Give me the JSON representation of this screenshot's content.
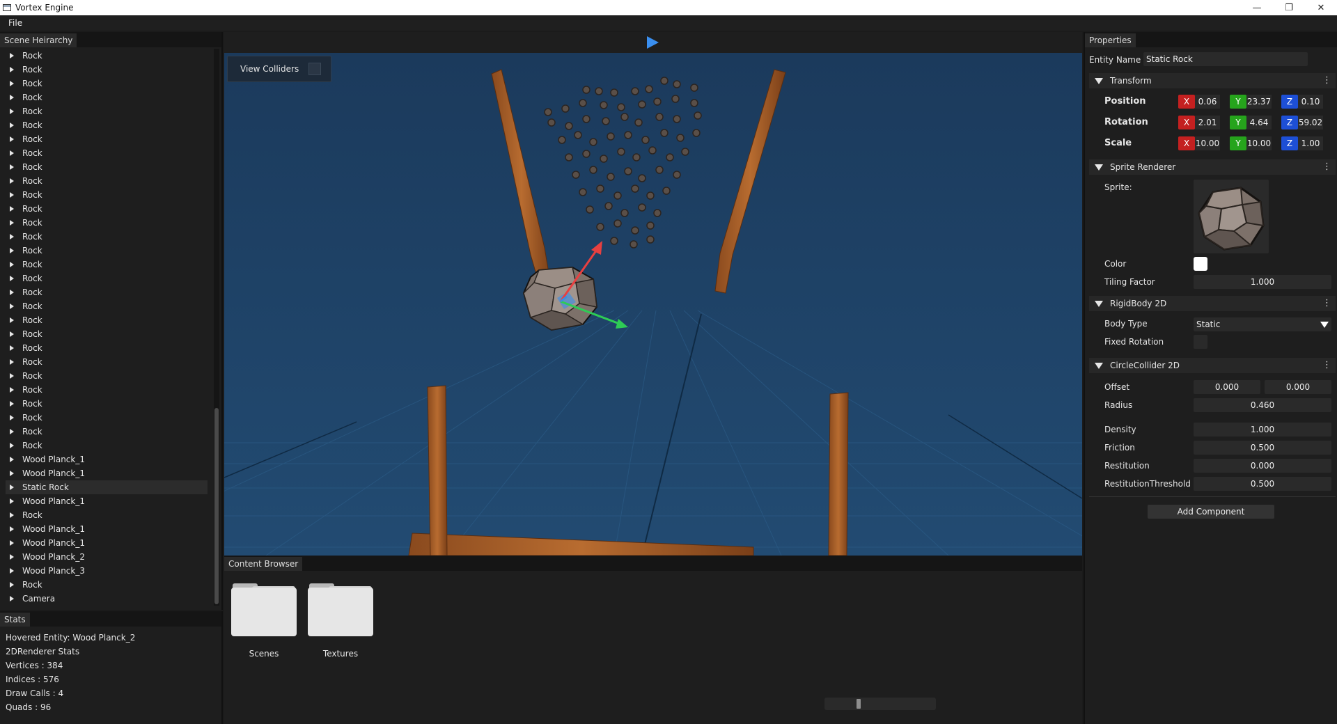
{
  "window": {
    "title": "Vortex Engine",
    "controls": {
      "minimize": "—",
      "restore": "❐",
      "close": "✕"
    }
  },
  "menu": {
    "file_label": "File"
  },
  "hierarchy": {
    "tab_label": "Scene Heirarchy",
    "items": [
      {
        "label": "Rock"
      },
      {
        "label": "Rock"
      },
      {
        "label": "Rock"
      },
      {
        "label": "Rock"
      },
      {
        "label": "Rock"
      },
      {
        "label": "Rock"
      },
      {
        "label": "Rock"
      },
      {
        "label": "Rock"
      },
      {
        "label": "Rock"
      },
      {
        "label": "Rock"
      },
      {
        "label": "Rock"
      },
      {
        "label": "Rock"
      },
      {
        "label": "Rock"
      },
      {
        "label": "Rock"
      },
      {
        "label": "Rock"
      },
      {
        "label": "Rock"
      },
      {
        "label": "Rock"
      },
      {
        "label": "Rock"
      },
      {
        "label": "Rock"
      },
      {
        "label": "Rock"
      },
      {
        "label": "Rock"
      },
      {
        "label": "Rock"
      },
      {
        "label": "Rock"
      },
      {
        "label": "Rock"
      },
      {
        "label": "Rock"
      },
      {
        "label": "Rock"
      },
      {
        "label": "Rock"
      },
      {
        "label": "Rock"
      },
      {
        "label": "Rock"
      },
      {
        "label": "Wood Planck_1"
      },
      {
        "label": "Wood Planck_1"
      },
      {
        "label": "Static Rock",
        "selected": true
      },
      {
        "label": "Wood Planck_1"
      },
      {
        "label": "Rock"
      },
      {
        "label": "Wood Planck_1"
      },
      {
        "label": "Wood Planck_1"
      },
      {
        "label": "Wood Planck_2"
      },
      {
        "label": "Wood Planck_3"
      },
      {
        "label": "Rock"
      },
      {
        "label": "Camera"
      }
    ]
  },
  "stats": {
    "tab_label": "Stats",
    "hovered": "Hovered Entity: Wood Planck_2",
    "renderer": "2DRenderer Stats",
    "vertices": "Vertices : 384",
    "indices": "Indices : 576",
    "draw_calls": "Draw Calls : 4",
    "quads": "Quads : 96"
  },
  "viewport": {
    "view_colliders_label": "View Colliders",
    "view_colliders_checked": false,
    "background_color": "#1e4063",
    "gizmo_colors": {
      "x": "#e84040",
      "y": "#2ecc55",
      "z": "#3b8fe0"
    }
  },
  "content_browser": {
    "tab_label": "Content Browser",
    "folders": [
      {
        "label": "Scenes"
      },
      {
        "label": "Textures"
      }
    ],
    "thumbnail_size_fraction": 0.3
  },
  "properties": {
    "tab_label": "Properties",
    "entity_name_label": "Entity Name",
    "entity_name": "Static Rock",
    "transform": {
      "header": "Transform",
      "position_label": "Position",
      "rotation_label": "Rotation",
      "scale_label": "Scale",
      "axis_x": "X",
      "axis_y": "Y",
      "axis_z": "Z",
      "position": {
        "x": "0.06",
        "y": "23.37",
        "z": "0.10"
      },
      "rotation": {
        "x": "2.01",
        "y": "4.64",
        "z": "59.02"
      },
      "scale": {
        "x": "10.00",
        "y": "10.00",
        "z": "1.00"
      }
    },
    "sprite_renderer": {
      "header": "Sprite Renderer",
      "sprite_label": "Sprite:",
      "color_label": "Color",
      "color_value": "#ffffff",
      "tiling_label": "Tiling Factor",
      "tiling_value": "1.000"
    },
    "rigidbody": {
      "header": "RigidBody 2D",
      "body_type_label": "Body Type",
      "body_type_value": "Static",
      "fixed_rotation_label": "Fixed Rotation",
      "fixed_rotation_checked": false
    },
    "circle_collider": {
      "header": "CircleCollider 2D",
      "offset_label": "Offset",
      "offset_x": "0.000",
      "offset_y": "0.000",
      "radius_label": "Radius",
      "radius_value": "0.460",
      "density_label": "Density",
      "density_value": "1.000",
      "friction_label": "Friction",
      "friction_value": "0.500",
      "restitution_label": "Restitution",
      "restitution_value": "0.000",
      "restitution_threshold_label": "RestitutionThreshold",
      "restitution_threshold_value": "0.500"
    },
    "menu_dots": "⋮",
    "add_component_label": "Add Component"
  }
}
